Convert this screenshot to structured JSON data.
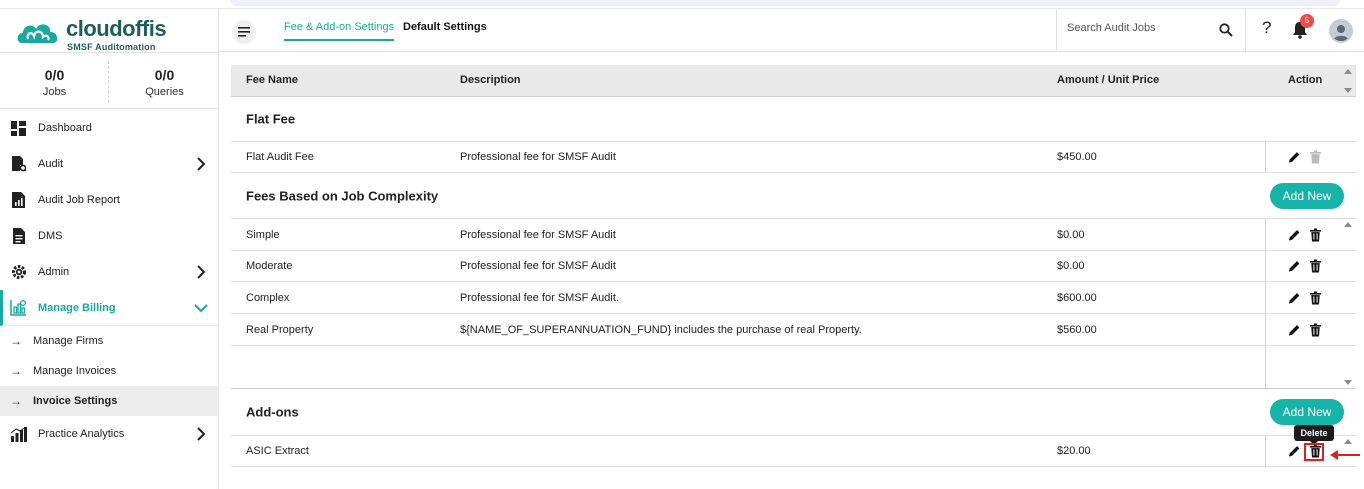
{
  "app": {
    "logo_name": "cloudoffis",
    "logo_tagline": "SMSF Auditomation"
  },
  "sidebar": {
    "stats": [
      {
        "value": "0/0",
        "label": "Jobs"
      },
      {
        "value": "0/0",
        "label": "Queries"
      }
    ],
    "items": [
      {
        "label": "Dashboard",
        "icon": "dashboard-icon"
      },
      {
        "label": "Audit",
        "icon": "audit-icon"
      },
      {
        "label": "Audit Job Report",
        "icon": "report-icon"
      },
      {
        "label": "DMS",
        "icon": "document-icon"
      },
      {
        "label": "Admin",
        "icon": "gear-icon"
      },
      {
        "label": "Manage Billing",
        "icon": "billing-icon"
      },
      {
        "label": "Practice Analytics",
        "icon": "analytics-icon"
      }
    ],
    "billing_sub": [
      {
        "label": "Manage Firms"
      },
      {
        "label": "Manage Invoices"
      },
      {
        "label": "Invoice Settings"
      }
    ]
  },
  "header": {
    "tabs": [
      {
        "label": "Fee & Add-on Settings"
      },
      {
        "label": "Default Settings"
      }
    ],
    "search_placeholder": "Search Audit Jobs",
    "help_label": "?",
    "notification_count": "5"
  },
  "table": {
    "columns": [
      "Fee Name",
      "Description",
      "Amount / Unit Price",
      "Action"
    ],
    "sections": {
      "flat": {
        "title": "Flat Fee",
        "rows": [
          {
            "name": "Flat Audit Fee",
            "description": "Professional fee for SMSF Audit",
            "amount": "$450.00"
          }
        ]
      },
      "complexity": {
        "title": "Fees Based on Job Complexity",
        "add_label": "Add New",
        "rows": [
          {
            "name": "Simple",
            "description": "Professional fee for SMSF Audit",
            "amount": "$0.00"
          },
          {
            "name": "Moderate",
            "description": "Professional fee for SMSF Audit",
            "amount": "$0.00"
          },
          {
            "name": "Complex",
            "description": "Professional fee for SMSF Audit.",
            "amount": "$600.00"
          },
          {
            "name": "Real Property",
            "description": "${NAME_OF_SUPERANNUATION_FUND} includes the purchase of real Property.",
            "amount": "$560.00"
          }
        ]
      },
      "addons": {
        "title": "Add-ons",
        "add_label": "Add New",
        "rows": [
          {
            "name": "ASIC Extract",
            "description": "",
            "amount": "$20.00"
          }
        ]
      }
    },
    "tooltip": "Delete"
  },
  "colors": {
    "accent": "#1aa9a0",
    "button": "#16b3a8",
    "badge": "#f04b4b",
    "highlight": "#e02020"
  }
}
